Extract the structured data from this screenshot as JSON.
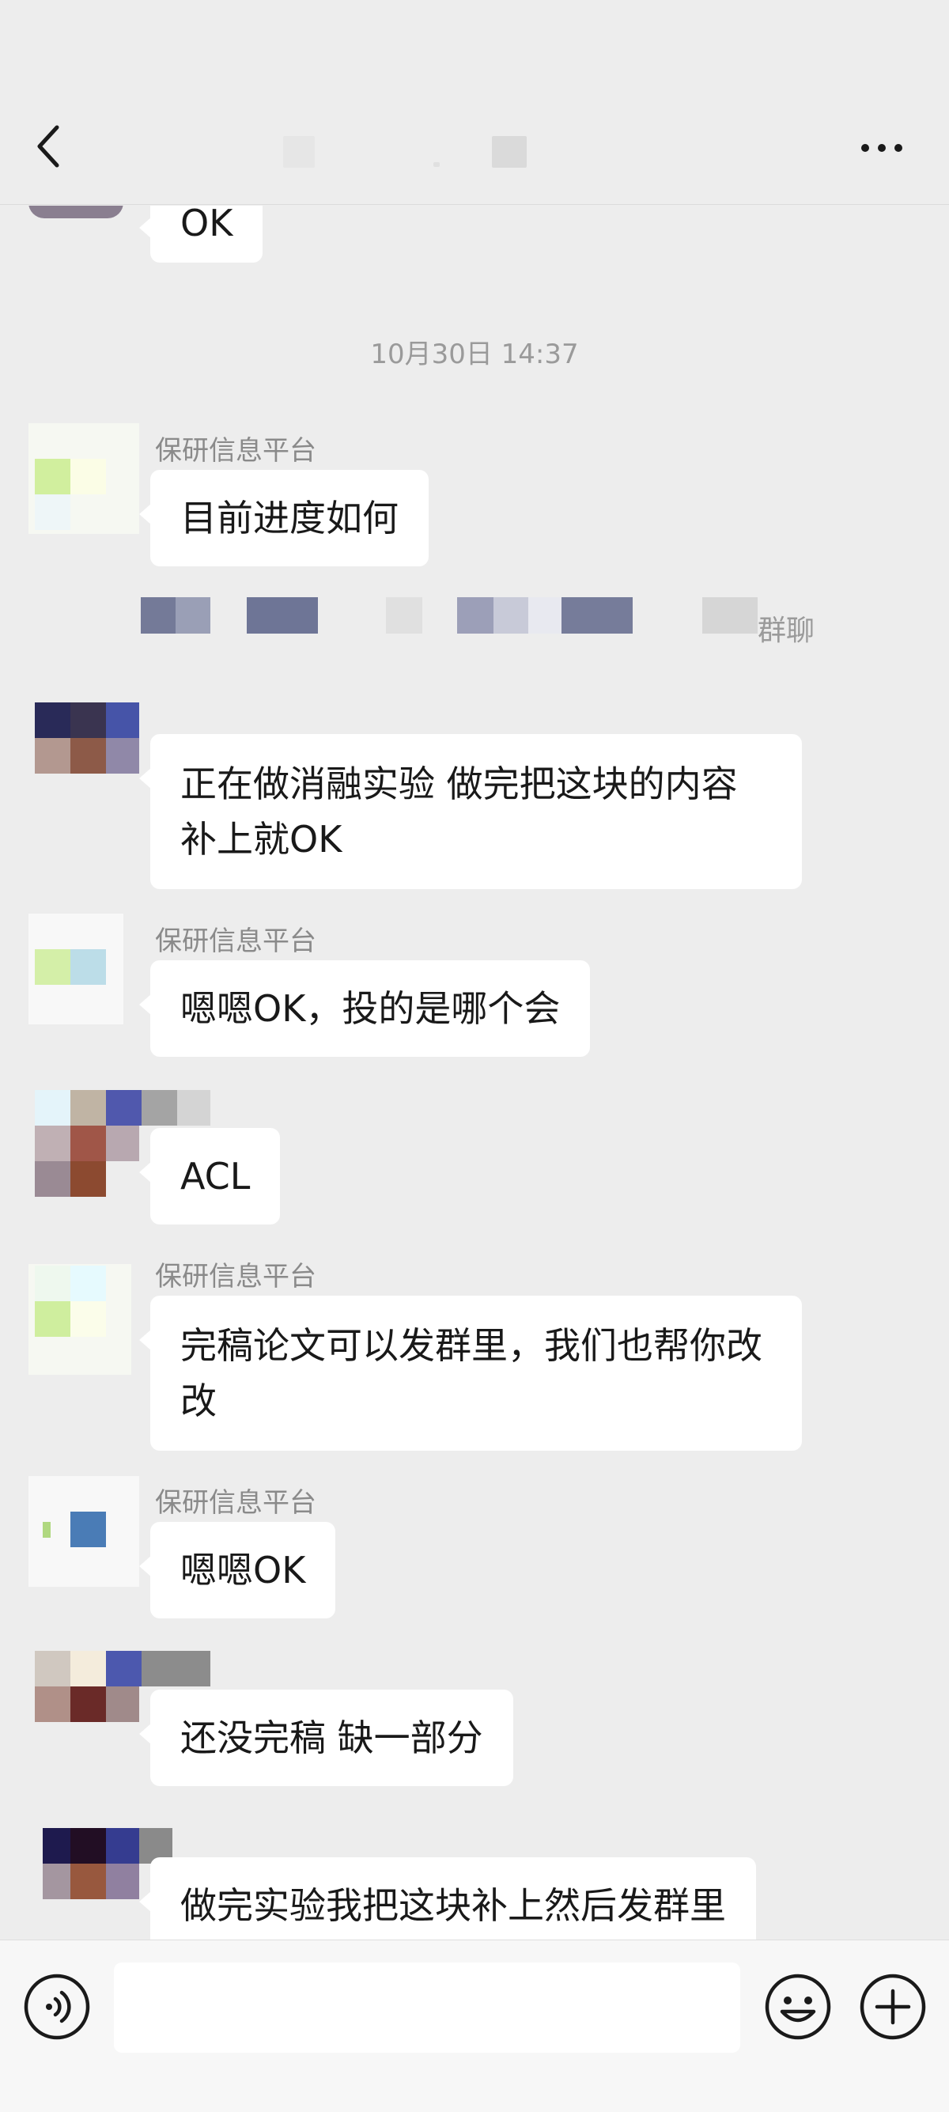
{
  "header": {
    "back_icon": "chevron-left-icon",
    "more_icon": "more-dots-icon"
  },
  "timestamp": "10月30日 14:37",
  "system_notice_tail": "群聊",
  "messages": [
    {
      "text": "OK"
    },
    {
      "sender": "保研信息平台",
      "text": "目前进度如何"
    },
    {
      "text": "正在做消融实验 做完把这块的内容补上就OK"
    },
    {
      "sender": "保研信息平台",
      "text": "嗯嗯OK，投的是哪个会"
    },
    {
      "text": "ACL"
    },
    {
      "sender": "保研信息平台",
      "text": "完稿论文可以发群里，我们也帮你改改"
    },
    {
      "sender": "保研信息平台",
      "text": "嗯嗯OK"
    },
    {
      "text": "还没完稿 缺一部分"
    },
    {
      "text": "做完实验我把这块补上然后发群里"
    }
  ],
  "input": {
    "value": "",
    "voice_icon": "voice-icon",
    "emoji_icon": "emoji-icon",
    "plus_icon": "plus-icon"
  }
}
